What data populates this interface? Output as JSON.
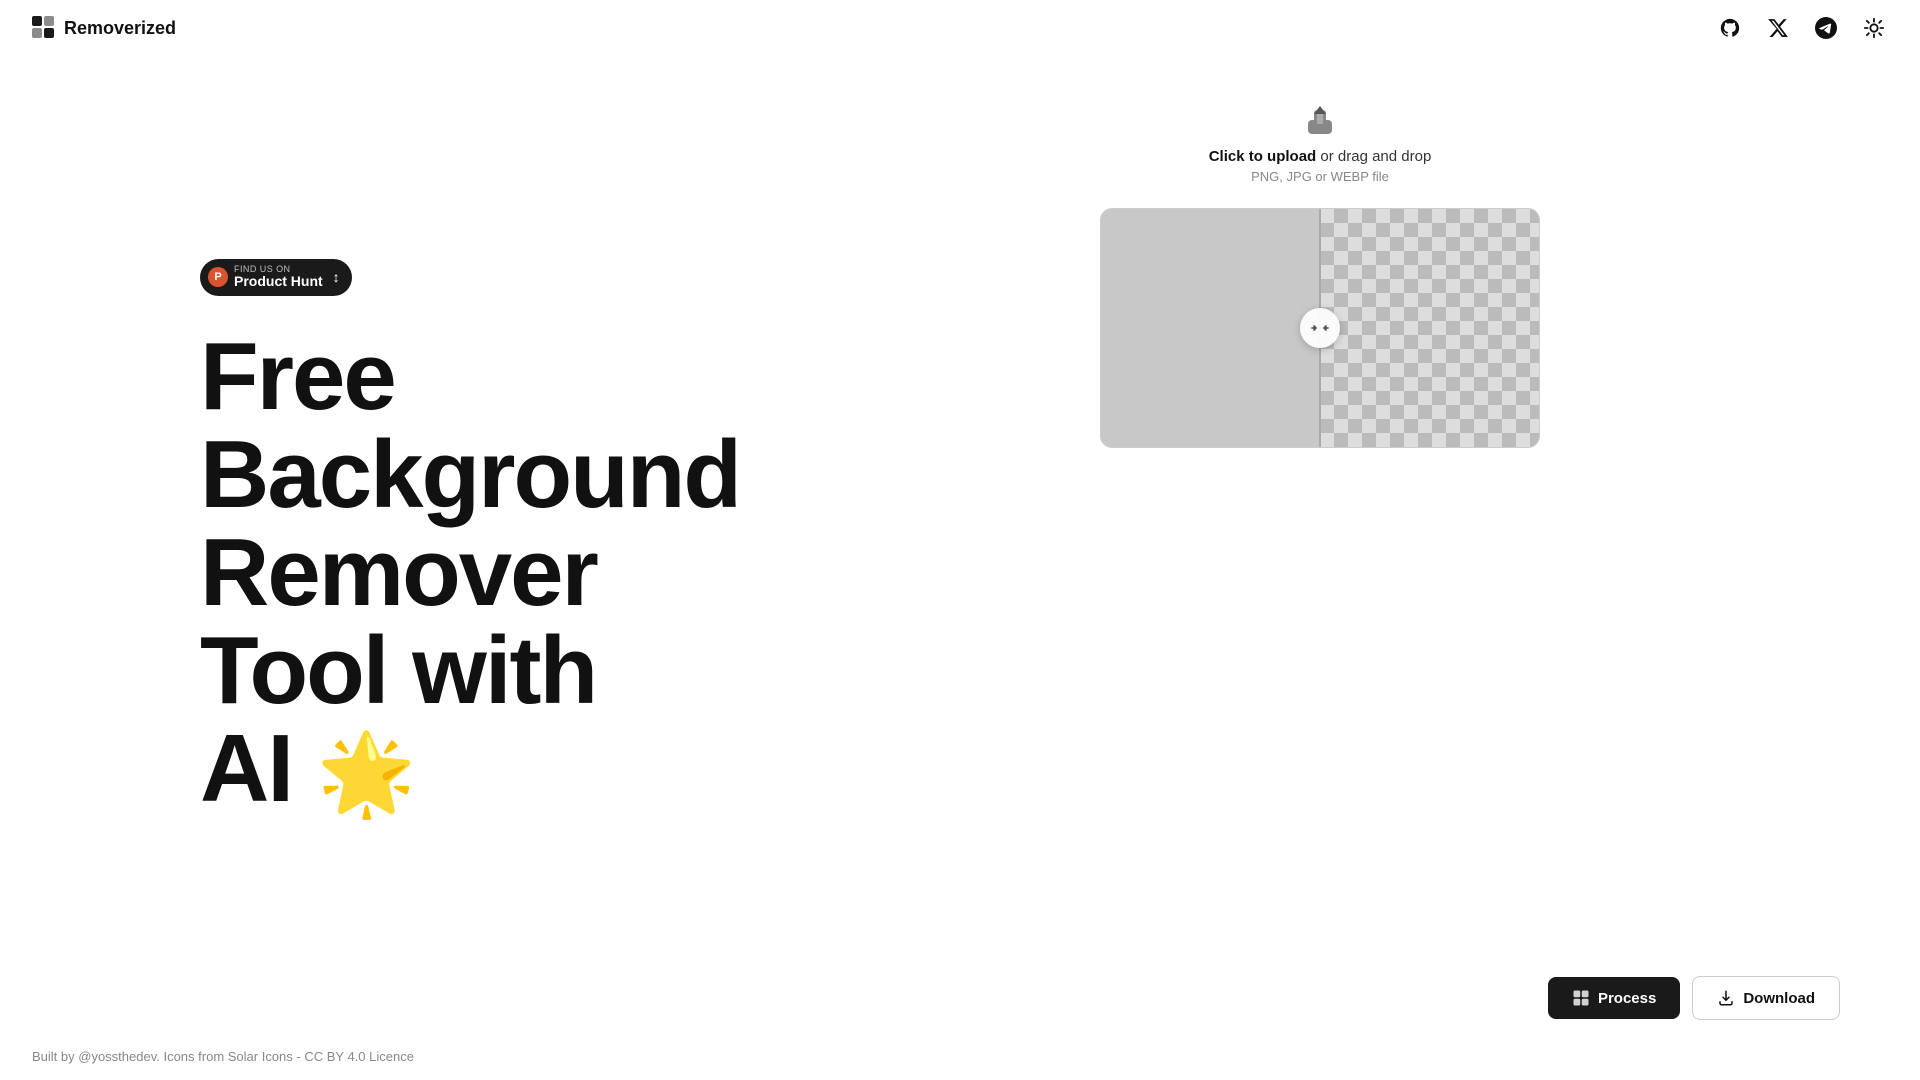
{
  "header": {
    "logo_text": "Removerized",
    "nav_items": [
      {
        "name": "github-icon",
        "label": "GitHub",
        "symbol": "github"
      },
      {
        "name": "twitter-x-icon",
        "label": "Twitter X",
        "symbol": "x"
      },
      {
        "name": "telegram-icon",
        "label": "Telegram",
        "symbol": "telegram"
      },
      {
        "name": "theme-toggle-icon",
        "label": "Toggle Theme",
        "symbol": "sun"
      }
    ]
  },
  "upload": {
    "click_label": "Click to upload",
    "drag_label": " or drag and drop",
    "hint": "PNG, JPG or WEBP file"
  },
  "badge": {
    "find_us": "FIND US ON",
    "name": "Product Hunt",
    "arrow": "↕"
  },
  "hero": {
    "line1": "Free",
    "line2": "Background",
    "line3": "Remover",
    "line4": "Tool with",
    "line5": "AI"
  },
  "actions": {
    "process_label": "Process",
    "download_label": "Download"
  },
  "footer": {
    "text": "Built by @yossthedev. Icons from Solar Icons - CC BY 4.0 Licence"
  }
}
